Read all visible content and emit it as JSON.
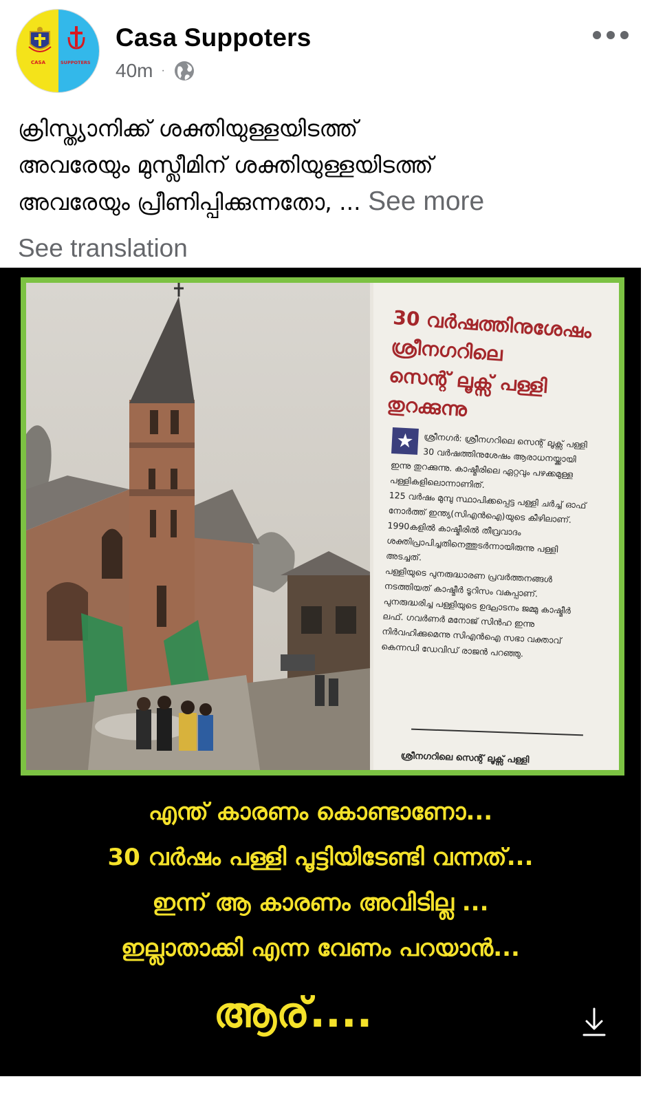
{
  "post": {
    "author": "Casa Suppoters",
    "time": "40m",
    "separator": "·",
    "privacy_icon": "globe-icon",
    "avatar": {
      "left_text": "CASA",
      "right_text": "SUPPOTERS",
      "left_color": "#f4e31a",
      "right_color": "#33b8ea"
    },
    "text_lines": [
      "ക്രിസ്ത്യാനിക്ക് ശക്തിയുള്ളയിടത്ത്",
      "അവരേയും മുസ്ലീമിന് ശക്തിയുള്ളയിടത്ത്",
      "അവരേയും പ്രീണിപ്പിക്കുന്നതോ, ..."
    ],
    "see_more": "See more",
    "see_translation": "See translation"
  },
  "image": {
    "headline_lines": [
      "30 വർഷത്തിനുശേഷം",
      "ശ്രീനഗറിലെ",
      "സെന്റ് ലൂക്സ് പള്ളി",
      "തുറക്കുന്നു"
    ],
    "body_paragraphs": [
      "ശ്രീനഗർ: ശ്രീനഗറിലെ സെന്റ് ലൂക്സ് പള്ളി 30 വർഷത്തിനുശേഷം ആരാധനയ്ക്കായി ഇന്നു തുറക്കുന്നു. കാഷ്മീരിലെ ഏറ്റവും പഴക്കമുള്ള പള്ളികളിലൊന്നാണിത്.",
      "125 വർഷം മുമ്പു സ്ഥാപിക്കപ്പെട്ട പള്ളി ചർച്ച് ഓഫ് നോർത്ത് ഇന്ത്യ(സിഎൻഐ)യുടെ കീഴിലാണ്. 1990കളിൽ കാഷ്മീരിൽ തീവ്രവാദം ശക്തിപ്രാപിച്ചതിനെത്തുടർന്നായിരുന്നു പള്ളി അടച്ചത്.",
      "പള്ളിയുടെ പുനരുദ്ധാരണ പ്രവർത്തനങ്ങൾ നടത്തിയത് കാഷ്മീർ ടൂറിസം വകുപ്പാണ്.",
      "പുനരുദ്ധരിച്ച പള്ളിയുടെ ഉദ്ഘാടനം ജമ്മു കാഷ്മീർ ലഫ്. ഗവർണർ മനോജ് സിൻഹ ഇന്നു നിർവഹിക്കുമെന്നു സിഎൻഐ സഭാ വക്താവ് കെന്നഡി ഡേവിഡ് രാജൻ പറഞ്ഞു."
    ],
    "caption": "ശ്രീനഗറിലെ സെന്റ് ലൂക്സ് പള്ളി",
    "overlay_lines": [
      "എന്ത് കാരണം കൊണ്ടാണോ...",
      "30 വർഷം പള്ളി പൂട്ടിയിടേണ്ടി വന്നത്...",
      "ഇന്ന് ആ കാരണം അവിടില്ല ...",
      "ഇല്ലാതാക്കി എന്ന വേണം പറയാൻ..."
    ],
    "overlay_big": "ആര്....",
    "overlay_color": "#f5e22a",
    "frame_color": "#7cc243",
    "download_icon": "download-icon"
  }
}
